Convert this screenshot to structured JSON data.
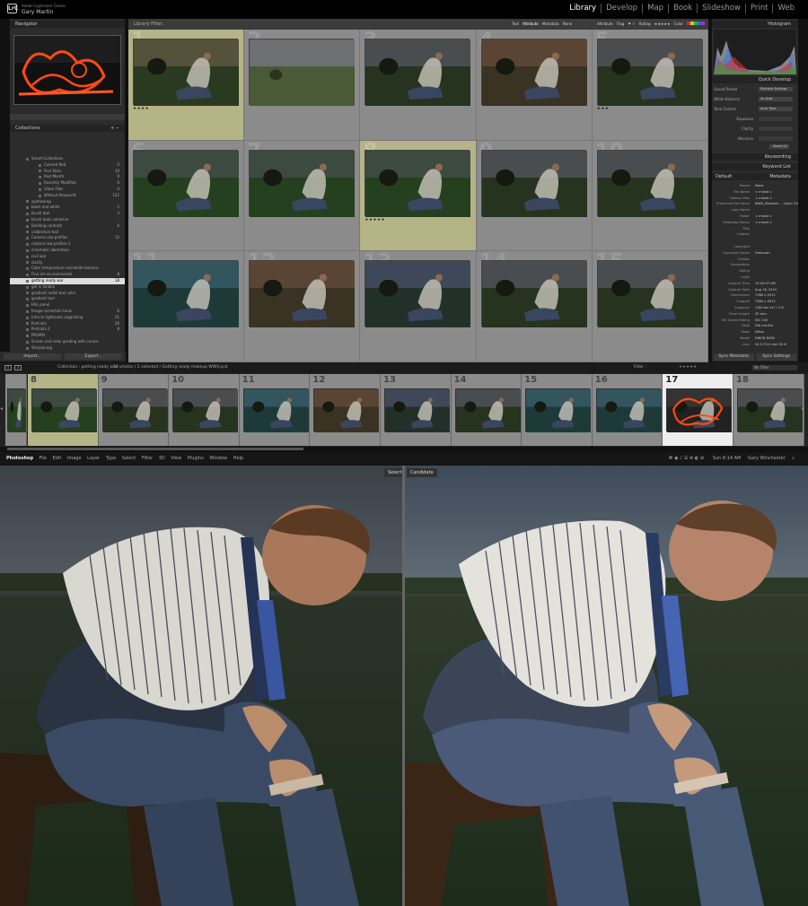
{
  "app": {
    "brand": "LrC",
    "product": "Adobe Lightroom Classic",
    "user": "Gary Martin",
    "modules": [
      "Library",
      "Develop",
      "Map",
      "Book",
      "Slideshow",
      "Print",
      "Web"
    ],
    "active_module": "Library"
  },
  "left_panel": {
    "navigator_label": "Navigator",
    "collections_label": "Collections",
    "collections": [
      {
        "name": "Smart Collections",
        "count": "",
        "sub": false
      },
      {
        "name": "Colored Red",
        "count": "0",
        "sub": true
      },
      {
        "name": "Five Stars",
        "count": "10",
        "sub": true
      },
      {
        "name": "Past Month",
        "count": "0",
        "sub": true
      },
      {
        "name": "Recently Modified",
        "count": "0",
        "sub": true
      },
      {
        "name": "Video Files",
        "count": "0",
        "sub": true
      },
      {
        "name": "Without Keywords",
        "count": "121",
        "sub": true
      },
      {
        "name": "spotlowing",
        "count": "",
        "sub": false
      },
      {
        "name": "black and white",
        "count": "5",
        "sub": false
      },
      {
        "name": "brush tool",
        "count": "3",
        "sub": false
      },
      {
        "name": "brush tools cohesive",
        "count": "",
        "sub": false
      },
      {
        "name": "Building contrast",
        "count": "6",
        "sub": false
      },
      {
        "name": "calibration tool",
        "count": "",
        "sub": false
      },
      {
        "name": "Camera raw profiles",
        "count": "12",
        "sub": false
      },
      {
        "name": "camera raw profiles 2",
        "count": "",
        "sub": false
      },
      {
        "name": "chromatic aberration",
        "count": "",
        "sub": false
      },
      {
        "name": "civil war",
        "count": "",
        "sub": false
      },
      {
        "name": "clarity",
        "count": "",
        "sub": false
      },
      {
        "name": "Color temperature and white balance",
        "count": "",
        "sub": false
      },
      {
        "name": "Fine art environmental",
        "count": "8",
        "sub": false
      },
      {
        "name": "getting ready war",
        "count": "18",
        "sub": false,
        "selected": true
      },
      {
        "name": "girl in london",
        "count": "",
        "sub": false
      },
      {
        "name": "gradient radial tool color",
        "count": "",
        "sub": false
      },
      {
        "name": "gradient tool",
        "count": "",
        "sub": false
      },
      {
        "name": "HSL panel",
        "count": "",
        "sub": false
      },
      {
        "name": "Image correction tools",
        "count": "6",
        "sub": false
      },
      {
        "name": "Intro to lightroom organizing",
        "count": "21",
        "sub": false
      },
      {
        "name": "Portraits",
        "count": "26",
        "sub": false
      },
      {
        "name": "Portraits 2",
        "count": "8",
        "sub": false
      },
      {
        "name": "PROMO",
        "count": "",
        "sub": false
      },
      {
        "name": "Screen and color grading with curves",
        "count": "",
        "sub": false
      },
      {
        "name": "Sharpening",
        "count": "",
        "sub": false
      },
      {
        "name": "Tone range control",
        "count": "",
        "sub": false
      }
    ],
    "import_label": "Import...",
    "export_label": "Export..."
  },
  "grid": {
    "header": "Library Filter:",
    "filter_tabs": [
      "Text",
      "Attribute",
      "Metadata",
      "None"
    ],
    "filter_attribute": "Attribute",
    "filter_flag": "Flag",
    "filter_rating": "Rating",
    "filter_color": "Color",
    "cells": [
      {
        "num": "1",
        "selected": true,
        "stars": "★★★★",
        "tone": "warm"
      },
      {
        "num": "2",
        "selected": false,
        "stars": "",
        "tone": "landscape"
      },
      {
        "num": "3",
        "selected": false,
        "stars": "",
        "tone": "normal"
      },
      {
        "num": "4",
        "selected": false,
        "stars": "",
        "tone": "brown"
      },
      {
        "num": "5",
        "selected": false,
        "stars": "★★★",
        "tone": "normal"
      },
      {
        "num": "6",
        "selected": false,
        "stars": "",
        "tone": "green"
      },
      {
        "num": "7",
        "selected": false,
        "stars": "",
        "tone": "green"
      },
      {
        "num": "8",
        "selected": true,
        "stars": "★★★★★",
        "tone": "green"
      },
      {
        "num": "9",
        "selected": false,
        "stars": "",
        "tone": "normal"
      },
      {
        "num": "10",
        "selected": false,
        "stars": "",
        "tone": "normal"
      },
      {
        "num": "11",
        "selected": false,
        "stars": "",
        "tone": "teal"
      },
      {
        "num": "12",
        "selected": false,
        "stars": "",
        "tone": "brown"
      },
      {
        "num": "13",
        "selected": false,
        "stars": "",
        "tone": "blue"
      },
      {
        "num": "14",
        "selected": false,
        "stars": "",
        "tone": "normal"
      },
      {
        "num": "15",
        "selected": false,
        "stars": "",
        "tone": "normal"
      }
    ]
  },
  "right_panel": {
    "histogram_label": "Histogram",
    "hist_info": [
      "ISO 100",
      "35 mm",
      "f/2.8",
      "1/60 sec"
    ],
    "quick_develop_label": "Quick Develop",
    "saved_preset_label": "Saved Preset",
    "saved_preset_value": "Multiple Settings",
    "white_balance_label": "White Balance",
    "white_balance_value": "As Shot",
    "tone_control_label": "Tone Control",
    "tone_control_value": "Auto Tone",
    "exposure_label": "Exposure",
    "clarity_label": "Clarity",
    "vibrance_label": "Vibrance",
    "reset_all_label": "Reset All",
    "keywording_label": "Keywording",
    "keyword_list_label": "Keyword List",
    "metadata_label": "Metadata",
    "metadata_preset": "Default",
    "metadata_rows": [
      {
        "k": "Preset",
        "v": "None"
      },
      {
        "k": "File Name",
        "v": "< mixed >"
      },
      {
        "k": "Sidecar Files",
        "v": "< mixed >"
      },
      {
        "k": "Preserved File Name",
        "v": "WWII_Stamset ... Color-72s3.nef"
      },
      {
        "k": "Copy Name",
        "v": ""
      },
      {
        "k": "Folder",
        "v": "< mixed >"
      },
      {
        "k": "Metadata Status",
        "v": "< mixed >"
      },
      {
        "k": "Title",
        "v": ""
      },
      {
        "k": "Caption",
        "v": ""
      },
      {
        "k": "",
        "v": ""
      },
      {
        "k": "Copyright",
        "v": ""
      },
      {
        "k": "Copyright Status",
        "v": "Unknown"
      },
      {
        "k": "Creator",
        "v": ""
      },
      {
        "k": "Sublocation",
        "v": ""
      },
      {
        "k": "Rating",
        "v": ""
      },
      {
        "k": "Label",
        "v": ""
      },
      {
        "k": "Capture Time",
        "v": "10:00:07 AM"
      },
      {
        "k": "Capture Date",
        "v": "Aug 18, 2019"
      },
      {
        "k": "Dimensions",
        "v": "7360 x 4912"
      },
      {
        "k": "Cropped",
        "v": "7360 x 4912"
      },
      {
        "k": "Exposure",
        "v": "1/60 sec at f / 2.8"
      },
      {
        "k": "Focal Length",
        "v": "35 mm"
      },
      {
        "k": "ISO Speed Rating",
        "v": "ISO 100"
      },
      {
        "k": "Flash",
        "v": "Did not fire"
      },
      {
        "k": "Make",
        "v": "Nikon"
      },
      {
        "k": "Model",
        "v": "NIKON D800"
      },
      {
        "k": "Lens",
        "v": "24.0-70.0 mm f/2.8"
      }
    ],
    "sync_metadata_label": "Sync Metadata",
    "sync_settings_label": "Sync Settings"
  },
  "filmstrip": {
    "page1": "1",
    "page2": "2",
    "source": "Collection : getting ready war",
    "summary": "18 photos / 2 selected / Getting ready makeup WWII.psd",
    "filter_label": "Filter :",
    "filter_value": "No Filter",
    "cells": [
      {
        "num": "",
        "tone": "green",
        "selected": false,
        "current": false
      },
      {
        "num": "8",
        "tone": "green",
        "selected": true,
        "current": false
      },
      {
        "num": "9",
        "tone": "normal",
        "selected": false,
        "current": false
      },
      {
        "num": "10",
        "tone": "normal",
        "selected": false,
        "current": false
      },
      {
        "num": "11",
        "tone": "teal",
        "selected": false,
        "current": false
      },
      {
        "num": "12",
        "tone": "brown",
        "selected": false,
        "current": false
      },
      {
        "num": "13",
        "tone": "blue",
        "selected": false,
        "current": false
      },
      {
        "num": "14",
        "tone": "normal",
        "selected": false,
        "current": false
      },
      {
        "num": "15",
        "tone": "teal",
        "selected": false,
        "current": false
      },
      {
        "num": "16",
        "tone": "teal",
        "selected": false,
        "current": false
      },
      {
        "num": "17",
        "tone": "mask",
        "selected": false,
        "current": true
      },
      {
        "num": "18",
        "tone": "normal",
        "selected": false,
        "current": false
      }
    ]
  },
  "photoshop_bar": {
    "app": "Photoshop",
    "menus": [
      "File",
      "Edit",
      "Image",
      "Layer",
      "Type",
      "Select",
      "Filter",
      "3D",
      "View",
      "Plugins",
      "Window",
      "Help"
    ],
    "clock": "Sun 8:14 AM",
    "user": "Gary Winchester"
  },
  "compare": {
    "select_label": "Select",
    "candidate_label": "Candidate"
  }
}
